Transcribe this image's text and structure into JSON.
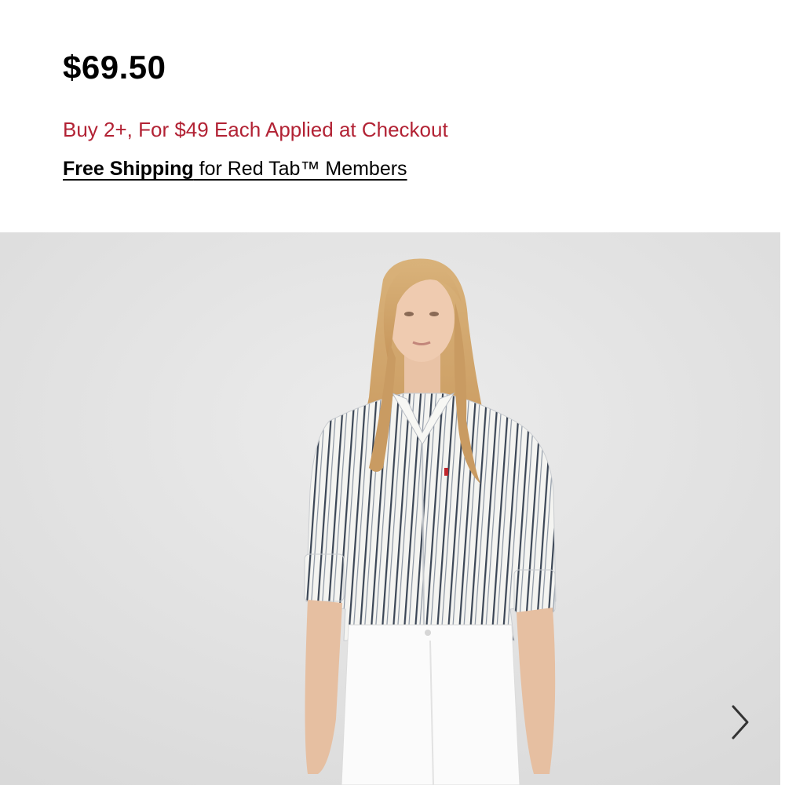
{
  "product": {
    "price": "$69.50",
    "promo": "Buy 2+, For $49 Each Applied at Checkout",
    "shipping_link": "Free Shipping",
    "shipping_rest": " for Red Tab™ Members"
  },
  "gallery": {
    "next_icon": "chevron-right-icon",
    "background": "#e3e3e3"
  },
  "colors": {
    "promo": "#b22234",
    "text": "#000000"
  }
}
